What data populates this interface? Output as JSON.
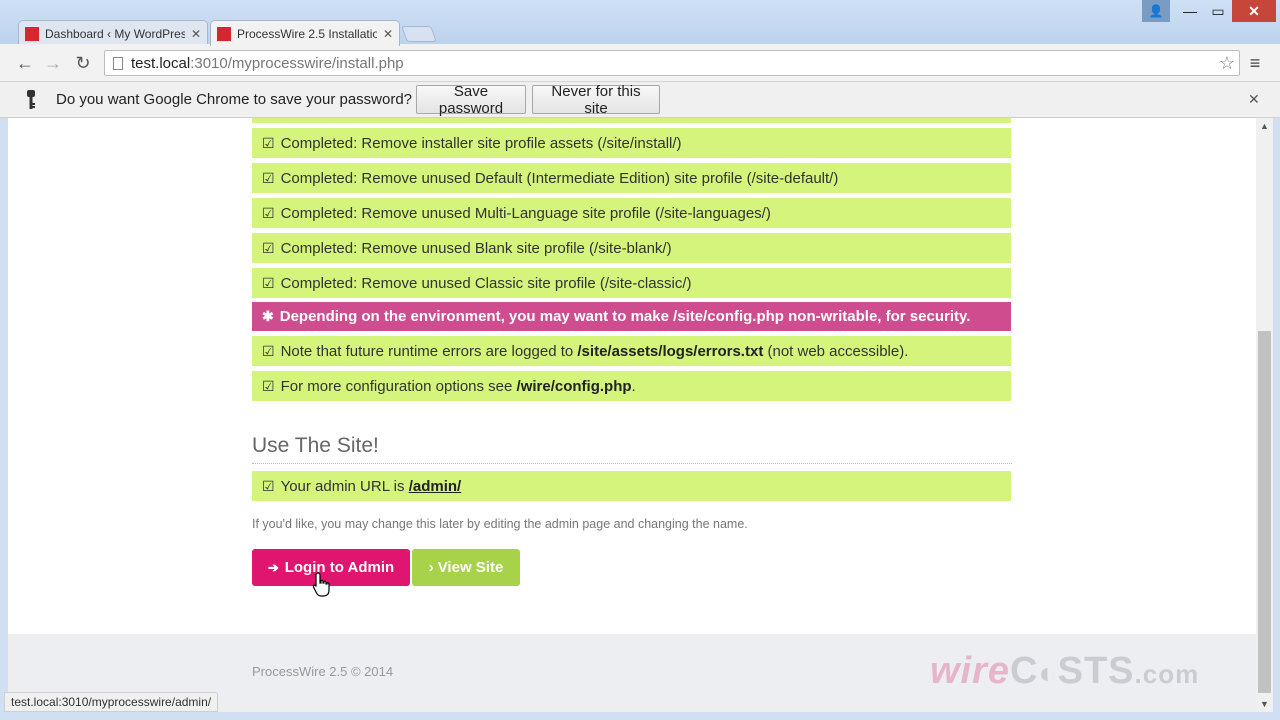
{
  "window": {
    "user_glyph": "👤",
    "minimize_glyph": "—",
    "maximize_glyph": "▭",
    "close_glyph": "✕"
  },
  "tabs": [
    {
      "label": "Dashboard ‹ My WordPres",
      "close": "✕",
      "active": false
    },
    {
      "label": "ProcessWire 2.5 Installatio",
      "close": "✕",
      "active": true
    }
  ],
  "toolbar": {
    "back_glyph": "←",
    "forward_glyph": "→",
    "reload_glyph": "↻",
    "url_host": "test.local",
    "url_rest": ":3010/myprocesswire/install.php",
    "star_glyph": "☆",
    "menu_glyph": "≡"
  },
  "infobar": {
    "question": "Do you want Google Chrome to save your password?",
    "save_label": "Save password",
    "never_label": "Never for this site",
    "close_glyph": "✕"
  },
  "messages": [
    {
      "prefix": "Completed: Remove installer site profile assets (/site/install/)",
      "bold": "",
      "suffix": ""
    },
    {
      "prefix": "Completed: Remove unused Default (Intermediate Edition) site profile (/site-default/)",
      "bold": "",
      "suffix": ""
    },
    {
      "prefix": "Completed: Remove unused Multi-Language site profile (/site-languages/)",
      "bold": "",
      "suffix": ""
    },
    {
      "prefix": "Completed: Remove unused Blank site profile (/site-blank/)",
      "bold": "",
      "suffix": ""
    },
    {
      "prefix": "Completed: Remove unused Classic site profile (/site-classic/)",
      "bold": "",
      "suffix": ""
    },
    {
      "prefix": "Depending on the environment, you may want to make /site/config.php non-writable, for security.",
      "bold": "",
      "suffix": ""
    },
    {
      "prefix": "Note that future runtime errors are logged to ",
      "bold": "/site/assets/logs/errors.txt",
      "suffix": " (not web accessible)."
    },
    {
      "prefix": "For more configuration options see ",
      "bold": "/wire/config.php",
      "suffix": "."
    }
  ],
  "icons": {
    "check": "☑",
    "warn": "✱"
  },
  "use_site": {
    "title": "Use The Site!",
    "admin_prefix": "Your admin URL is ",
    "admin_link": "/admin/",
    "hint": "If you'd like, you may change this later by editing the admin page and changing the name."
  },
  "buttons": {
    "login_icon": "➔",
    "login_label": "Login to Admin",
    "view_icon": "›",
    "view_label": "View Site"
  },
  "footer": {
    "text": "ProcessWire 2.5 © 2014",
    "wm_wire": "wire",
    "wm_casts": "C",
    "wm_casts2": "STS",
    "wm_dom": ".com"
  },
  "statusbar": {
    "url": "test.local:3010/myprocesswire/admin/"
  },
  "colors": {
    "success": "#d4f47c",
    "warning": "#cf4d8f",
    "login_button": "#e0156f",
    "view_button": "#a9d24b"
  }
}
